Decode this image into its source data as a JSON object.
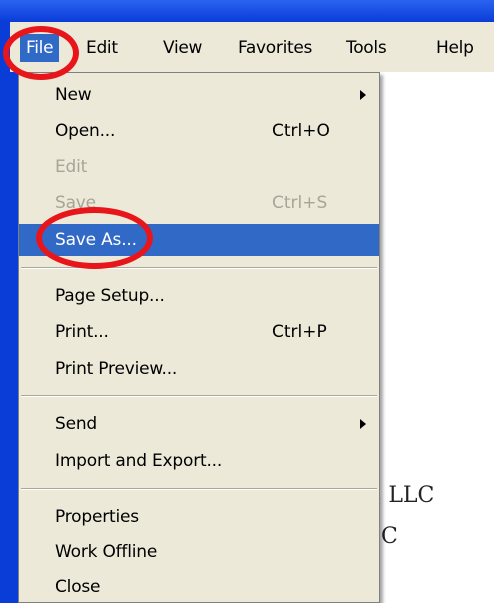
{
  "menubar": {
    "items": [
      {
        "label": "File"
      },
      {
        "label": "Edit"
      },
      {
        "label": "View"
      },
      {
        "label": "Favorites"
      },
      {
        "label": "Tools"
      },
      {
        "label": "Help"
      }
    ]
  },
  "file_menu": {
    "items": [
      {
        "label": "New",
        "shortcut": "",
        "state": "enabled",
        "submenu": true
      },
      {
        "label": "Open...",
        "shortcut": "Ctrl+O",
        "state": "enabled"
      },
      {
        "label": "Edit",
        "shortcut": "",
        "state": "disabled"
      },
      {
        "label": "Save",
        "shortcut": "Ctrl+S",
        "state": "disabled"
      },
      {
        "label": "Save As...",
        "shortcut": "",
        "state": "highlighted"
      },
      {
        "label": "Page Setup...",
        "shortcut": "",
        "state": "enabled"
      },
      {
        "label": "Print...",
        "shortcut": "Ctrl+P",
        "state": "enabled"
      },
      {
        "label": "Print Preview...",
        "shortcut": "",
        "state": "enabled"
      },
      {
        "label": "Send",
        "shortcut": "",
        "state": "enabled",
        "submenu": true
      },
      {
        "label": "Import and Export...",
        "shortcut": "",
        "state": "enabled"
      },
      {
        "label": "Properties",
        "shortcut": "",
        "state": "enabled"
      },
      {
        "label": "Work Offline",
        "shortcut": "",
        "state": "enabled"
      },
      {
        "label": "Close",
        "shortcut": "",
        "state": "enabled"
      }
    ]
  },
  "document": {
    "line1": "c LLC",
    "line2": "C"
  },
  "colors": {
    "highlight": "#3169C6",
    "annotation": "#E8161B",
    "menu_background": "#ECE9D8",
    "disabled_text": "#A8A598"
  }
}
